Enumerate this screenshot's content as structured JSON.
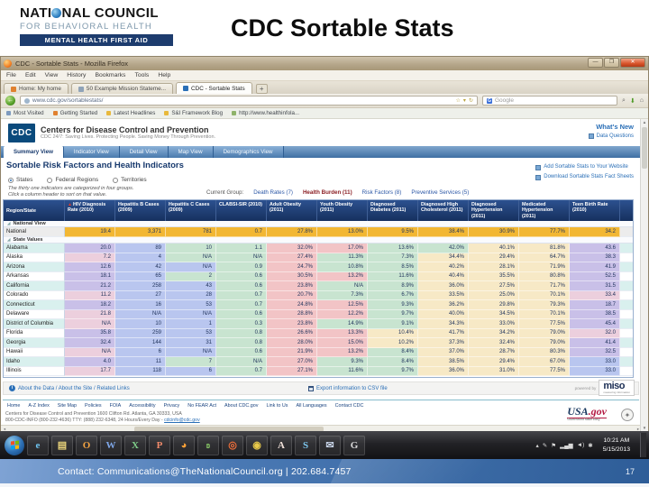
{
  "slide": {
    "logo": {
      "line1_a": "NATI",
      "line1_b": "NAL COUNCIL",
      "line2": "FOR BEHAVIORAL HEALTH",
      "banner": "MENTAL HEALTH FIRST AID"
    },
    "title": "CDC Sortable Stats",
    "footer": {
      "contact": "Contact: Communications@TheNationalCouncil.org  |  202.684.7457",
      "page_number": "17"
    }
  },
  "browser": {
    "window_title": "CDC - Sortable Stats - Mozilla Firefox",
    "window_buttons": {
      "minimize": "—",
      "restore": "❐",
      "close": "✕"
    },
    "menu": [
      "File",
      "Edit",
      "View",
      "History",
      "Bookmarks",
      "Tools",
      "Help"
    ],
    "tabs": [
      {
        "label": "Home: My home",
        "fav": "#e0812f",
        "active": false
      },
      {
        "label": "50 Example Mission Stateme...",
        "fav": "#8fa3b8",
        "active": false
      },
      {
        "label": "CDC - Sortable Stats",
        "fav": "#2a6fb7",
        "active": true
      }
    ],
    "new_tab_label": "+",
    "url": "www.cdc.gov/sortablestats/",
    "url_icons": {
      "star": "☆",
      "dropdown": "▾",
      "reload": "↻"
    },
    "search_placeholder": "Google",
    "search_icons": {
      "g": "G",
      "magnifier": "🔍",
      "download": "⬇",
      "home": "⌂"
    },
    "bookmarks": [
      {
        "label": "Most Visited",
        "dot": "#7d9bbf"
      },
      {
        "label": "Getting Started",
        "dot": "#e0812f"
      },
      {
        "label": "Latest Headlines",
        "dot": "#e8b93c"
      },
      {
        "label": "S&I Framework Blog",
        "dot": "#e8b93c"
      },
      {
        "label": "http://www.healthinfola...",
        "dot": "#8fb36a"
      }
    ]
  },
  "page": {
    "site_name": "Centers for Disease Control and Prevention",
    "site_tagline": "CDC 24/7: Saving Lives. Protecting People. Saving Money Through Prevention.",
    "cdc_logo_text": "CDC",
    "whats_new": "What's New",
    "data_questions": "Data Questions",
    "nav_tabs": [
      {
        "label": "Summary View",
        "active": true
      },
      {
        "label": "Indicator View",
        "active": false
      },
      {
        "label": "Detail View",
        "active": false
      },
      {
        "label": "Map View",
        "active": false
      },
      {
        "label": "Demographics View",
        "active": false
      }
    ],
    "section_title": "Sortable Risk Factors and Health Indicators",
    "side_links": [
      "Add Sortable Stats to Your Website",
      "Download Sortable Stats Fact Sheets"
    ],
    "radios": [
      {
        "label": "States",
        "selected": true
      },
      {
        "label": "Federal Regions",
        "selected": false
      },
      {
        "label": "Territories",
        "selected": false
      }
    ],
    "note_line1": "The thirty one indicators are categorized in four groups.",
    "note_line2": "Click a column header to sort on that value.",
    "current_group_label": "Current Group:",
    "groups": [
      {
        "label": "Death Rates (7)",
        "selected": false
      },
      {
        "label": "Health Burden (11)",
        "selected": true
      },
      {
        "label": "Risk Factors (8)",
        "selected": false
      },
      {
        "label": "Preventive Services (5)",
        "selected": false
      }
    ],
    "about_links": "About the Data / About the Site / Related Links",
    "export_link": "Export information to CSV file",
    "powered_by": "powered by",
    "miso": "miso",
    "miso_sub": "measuring information",
    "footer_links": [
      "Home",
      "A-Z Index",
      "Site Map",
      "Policies",
      "FOIA",
      "Accessibility",
      "Privacy",
      "No FEAR Act",
      "About CDC.gov",
      "Link to Us",
      "All Languages",
      "Contact CDC"
    ],
    "address_line1": "Centers for Disease Control and Prevention   1600 Clifton Rd. Atlanta, GA 30333, USA",
    "address_line2": "800-CDC-INFO (800-232-4636) TTY: (888) 232-6348, 24 Hours/Every Day - ",
    "address_email": "cdcinfo@cdc.gov",
    "usa_gov_a": "USA",
    "usa_gov_b": ".gov",
    "usa_gov_tag": "Government Made Easy"
  },
  "table": {
    "columns": [
      "Region/State",
      "HIV Diagnosis Rate (2010)",
      "Hepatitis B Cases (2009)",
      "Hepatitis C Cases (2009)",
      "CLABSI-SIR (2010)",
      "Adult Obesity (2011)",
      "Youth Obesity (2011)",
      "Diagnosed Diabetes (2011)",
      "Diagnosed High Cholesterol (2011)",
      "Diagnosed Hypertension (2011)",
      "Medicated Hypertension (2011)",
      "Teen Birth Rate (2010)"
    ],
    "sort_column_index": 1,
    "group_national": "National View",
    "group_states": "State Values",
    "national": {
      "name": "National",
      "values": [
        "19.4",
        "3,371",
        "781",
        "0.7",
        "27.8%",
        "13.0%",
        "9.5%",
        "38.4%",
        "30.9%",
        "77.7%",
        "34.2"
      ]
    },
    "states": [
      {
        "name": "Alabama",
        "values": [
          "20.0",
          "89",
          "10",
          "1.1",
          "32.0%",
          "17.0%",
          "13.6%",
          "42.0%",
          "40.1%",
          "81.8%",
          "43.6"
        ],
        "colors": [
          "V",
          "B",
          "G",
          "G",
          "R",
          "R",
          "G",
          "G",
          "Y",
          "Y",
          "V"
        ]
      },
      {
        "name": "Alaska",
        "values": [
          "7.2",
          "4",
          "N/A",
          "N/A",
          "27.4%",
          "11.3%",
          "7.3%",
          "34.4%",
          "29.4%",
          "64.7%",
          "38.3"
        ],
        "colors": [
          "P",
          "B",
          "G",
          "G",
          "R",
          "G",
          "G",
          "Y",
          "Y",
          "Y",
          "V"
        ]
      },
      {
        "name": "Arizona",
        "values": [
          "12.6",
          "42",
          "N/A",
          "0.9",
          "24.7%",
          "10.8%",
          "8.5%",
          "40.2%",
          "28.1%",
          "71.9%",
          "41.9"
        ],
        "colors": [
          "V",
          "B",
          "B",
          "G",
          "R",
          "G",
          "G",
          "Y",
          "Y",
          "Y",
          "V"
        ]
      },
      {
        "name": "Arkansas",
        "values": [
          "18.1",
          "65",
          "2",
          "0.6",
          "30.5%",
          "13.2%",
          "11.6%",
          "40.4%",
          "35.5%",
          "80.8%",
          "52.5"
        ],
        "colors": [
          "V",
          "B",
          "G",
          "G",
          "R",
          "R",
          "G",
          "Y",
          "Y",
          "Y",
          "V"
        ]
      },
      {
        "name": "California",
        "values": [
          "21.2",
          "258",
          "43",
          "0.6",
          "23.8%",
          "N/A",
          "8.9%",
          "36.0%",
          "27.5%",
          "71.7%",
          "31.5"
        ],
        "colors": [
          "V",
          "B",
          "B",
          "G",
          "R",
          "G",
          "G",
          "Y",
          "Y",
          "Y",
          "V"
        ]
      },
      {
        "name": "Colorado",
        "values": [
          "11.2",
          "27",
          "28",
          "0.7",
          "20.7%",
          "7.3%",
          "6.7%",
          "33.5%",
          "25.0%",
          "70.1%",
          "33.4"
        ],
        "colors": [
          "P",
          "B",
          "B",
          "G",
          "R",
          "G",
          "G",
          "Y",
          "Y",
          "Y",
          "P"
        ]
      },
      {
        "name": "Connecticut",
        "values": [
          "18.2",
          "16",
          "53",
          "0.7",
          "24.8%",
          "12.5%",
          "9.3%",
          "36.2%",
          "29.8%",
          "79.3%",
          "18.7"
        ],
        "colors": [
          "V",
          "B",
          "B",
          "G",
          "R",
          "R",
          "G",
          "Y",
          "Y",
          "Y",
          "V"
        ]
      },
      {
        "name": "Delaware",
        "values": [
          "21.8",
          "N/A",
          "N/A",
          "0.6",
          "28.8%",
          "12.2%",
          "9.7%",
          "40.0%",
          "34.5%",
          "70.1%",
          "38.5"
        ],
        "colors": [
          "P",
          "B",
          "B",
          "G",
          "R",
          "R",
          "G",
          "Y",
          "Y",
          "Y",
          "V"
        ]
      },
      {
        "name": "District of Columbia",
        "values": [
          "N/A",
          "10",
          "1",
          "0.3",
          "23.8%",
          "14.9%",
          "9.1%",
          "34.3%",
          "33.0%",
          "77.5%",
          "45.4"
        ],
        "colors": [
          "P",
          "B",
          "B",
          "G",
          "R",
          "G",
          "G",
          "Y",
          "Y",
          "Y",
          "V"
        ]
      },
      {
        "name": "Florida",
        "values": [
          "35.8",
          "259",
          "53",
          "0.8",
          "26.6%",
          "13.3%",
          "10.4%",
          "41.7%",
          "34.2%",
          "79.0%",
          "32.0"
        ],
        "colors": [
          "V",
          "B",
          "B",
          "G",
          "R",
          "R",
          "Y",
          "Y",
          "Y",
          "Y",
          "P"
        ]
      },
      {
        "name": "Georgia",
        "values": [
          "32.4",
          "144",
          "31",
          "0.8",
          "28.0%",
          "15.0%",
          "10.2%",
          "37.3%",
          "32.4%",
          "79.0%",
          "41.4"
        ],
        "colors": [
          "V",
          "B",
          "B",
          "G",
          "R",
          "R",
          "Y",
          "Y",
          "Y",
          "Y",
          "V"
        ]
      },
      {
        "name": "Hawaii",
        "values": [
          "N/A",
          "6",
          "N/A",
          "0.6",
          "21.9%",
          "13.2%",
          "8.4%",
          "37.0%",
          "28.7%",
          "80.3%",
          "32.5"
        ],
        "colors": [
          "P",
          "B",
          "B",
          "G",
          "R",
          "R",
          "G",
          "Y",
          "Y",
          "Y",
          "V"
        ]
      },
      {
        "name": "Idaho",
        "values": [
          "4.0",
          "11",
          "7",
          "N/A",
          "27.0%",
          "9.3%",
          "8.4%",
          "38.5%",
          "29.4%",
          "67.0%",
          "33.0"
        ],
        "colors": [
          "V",
          "B",
          "G",
          "G",
          "R",
          "G",
          "G",
          "Y",
          "Y",
          "Y",
          "B"
        ]
      },
      {
        "name": "Illinois",
        "values": [
          "17.7",
          "118",
          "6",
          "0.7",
          "27.1%",
          "11.6%",
          "9.7%",
          "36.0%",
          "31.0%",
          "77.5%",
          "33.0"
        ],
        "colors": [
          "P",
          "B",
          "B",
          "G",
          "R",
          "G",
          "G",
          "Y",
          "Y",
          "Y",
          "B"
        ]
      }
    ],
    "palette": {
      "P": "#eccfdd",
      "V": "#c9c0e8",
      "B": "#b9c6ef",
      "G": "#c8e4d0",
      "R": "#f2c4c6",
      "Y": "#f7e9c6"
    },
    "national_color": "#f2b733",
    "name_stripe_a": "#d9f0ee",
    "name_stripe_b": "#ffffff",
    "header_color": "#1c3a6e"
  },
  "taskbar": {
    "icons": [
      {
        "name": "internet-explorer-icon",
        "glyph": "e",
        "color": "#6fc6f2"
      },
      {
        "name": "notes-icon",
        "glyph": "▤",
        "color": "#e8d27a"
      },
      {
        "name": "outlook-icon",
        "glyph": "O",
        "color": "#f0a242"
      },
      {
        "name": "word-icon",
        "glyph": "W",
        "color": "#7fa8e8"
      },
      {
        "name": "excel-icon",
        "glyph": "X",
        "color": "#7fcf8a"
      },
      {
        "name": "powerpoint-icon",
        "glyph": "P",
        "color": "#f08a6a"
      },
      {
        "name": "firefox-icon",
        "glyph": "◕",
        "color": "#ffa238"
      },
      {
        "name": "evernote-icon",
        "glyph": "ʚ",
        "color": "#8fd46a"
      },
      {
        "name": "opera-icon",
        "glyph": "◎",
        "color": "#f2703a"
      },
      {
        "name": "chrome-icon",
        "glyph": "◉",
        "color": "#e8c94a"
      },
      {
        "name": "adobe-reader-icon",
        "glyph": "A",
        "color": "#f2e2da"
      },
      {
        "name": "skype-icon",
        "glyph": "S",
        "color": "#7ec8f0"
      },
      {
        "name": "outlook-web-icon",
        "glyph": "✉",
        "color": "#c8d4e8"
      },
      {
        "name": "gimp-icon",
        "glyph": "G",
        "color": "#d8d8d8"
      }
    ],
    "tray_icons": [
      {
        "name": "show-hidden-icons",
        "glyph": "▴"
      },
      {
        "name": "pen-icon",
        "glyph": "✎"
      },
      {
        "name": "action-center-icon",
        "glyph": "⚑"
      },
      {
        "name": "network-icon",
        "glyph": "▂▄▆"
      },
      {
        "name": "volume-icon",
        "glyph": "◄)"
      },
      {
        "name": "bluetooth-icon",
        "glyph": "✱"
      }
    ],
    "time": "10:21 AM",
    "date": "5/15/2013"
  }
}
